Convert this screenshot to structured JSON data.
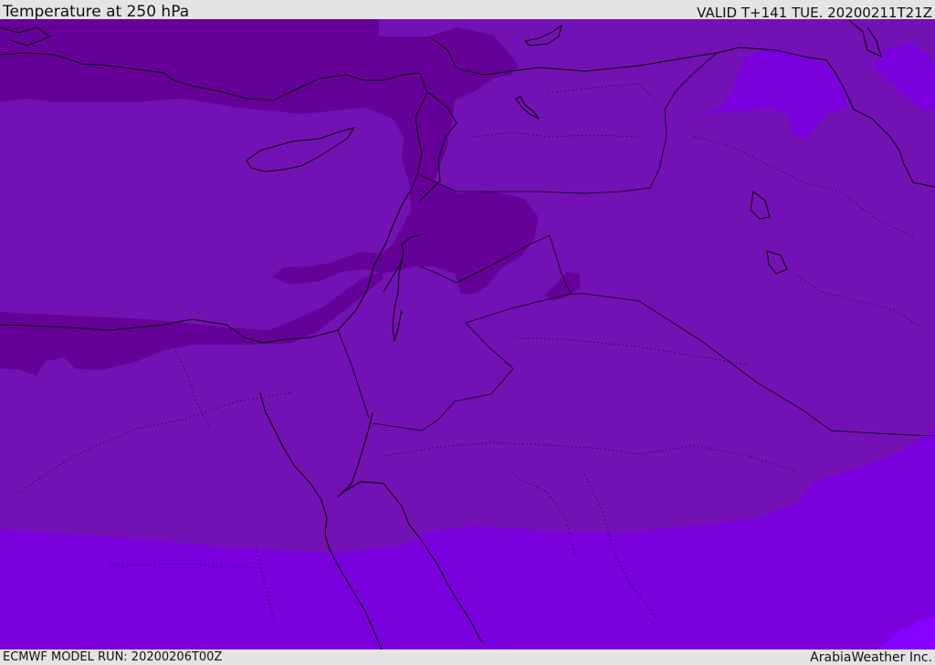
{
  "header": {
    "title": "Temperature at 250 hPa",
    "valid": "VALID T+141 TUE. 20200211T21Z"
  },
  "footer": {
    "model_run": "ECMWF MODEL RUN: 20200206T00Z",
    "brand": "ArabiaWeather Inc."
  },
  "colors": {
    "band_coldest": "#650099",
    "band_cold": "#7312b4",
    "band_mid": "#7a00dd",
    "band_warm": "#8800ff",
    "coast": "#000000",
    "border": "#000000"
  }
}
